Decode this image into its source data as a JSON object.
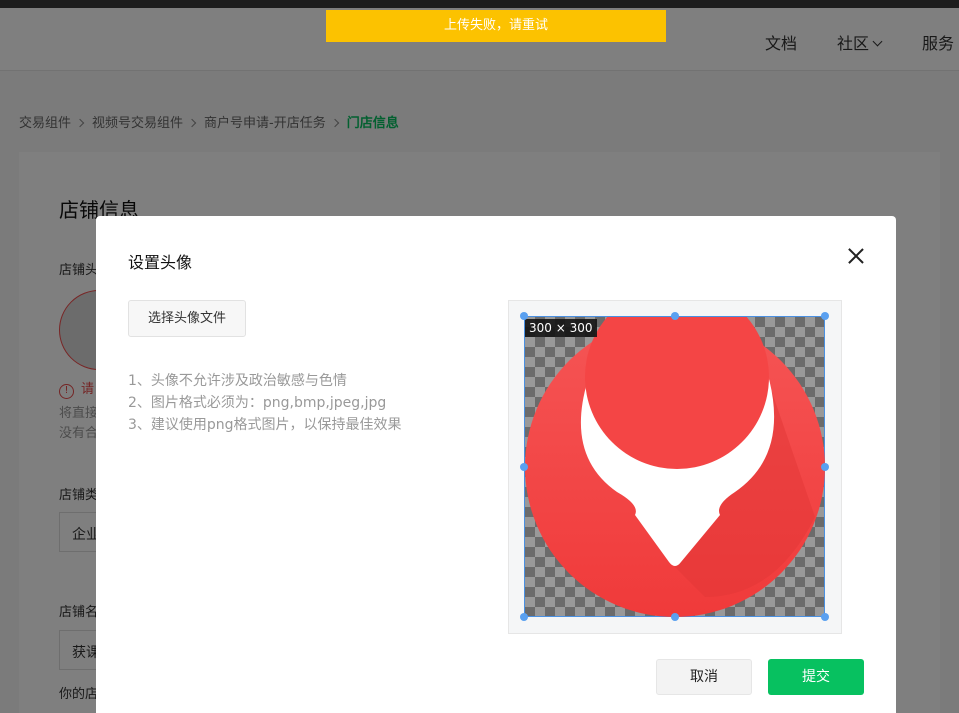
{
  "toast": {
    "text": "上传失败，请重试"
  },
  "header": {
    "nav": [
      {
        "label": "文档"
      },
      {
        "label": "社区"
      },
      {
        "label": "服务"
      }
    ]
  },
  "breadcrumb": {
    "items": [
      "交易组件",
      "视频号交易组件",
      "商户号申请-开店任务"
    ],
    "current": "门店信息"
  },
  "page": {
    "title": "店铺信息",
    "avatar_label": "店铺头",
    "avatar_error": "请",
    "hint_line1": "将直接",
    "hint_line2": "没有合",
    "type_label": "店铺类",
    "type_value": "企业",
    "name_label": "店铺名",
    "name_value": "获课",
    "bottom_text": "你的店"
  },
  "modal": {
    "title": "设置头像",
    "choose_button": "选择头像文件",
    "rules": [
      "1、头像不允许涉及政治敏感与色情",
      "2、图片格式必须为：png,bmp,jpeg,jpg",
      "3、建议使用png格式图片，以保持最佳效果"
    ],
    "crop_dimensions": "300 × 300",
    "cancel_button": "取消",
    "submit_button": "提交"
  },
  "colors": {
    "accent_green": "#07c160",
    "toast_yellow": "#fcc200",
    "logo_red": "#f44141",
    "crop_blue": "#4a90e2"
  }
}
